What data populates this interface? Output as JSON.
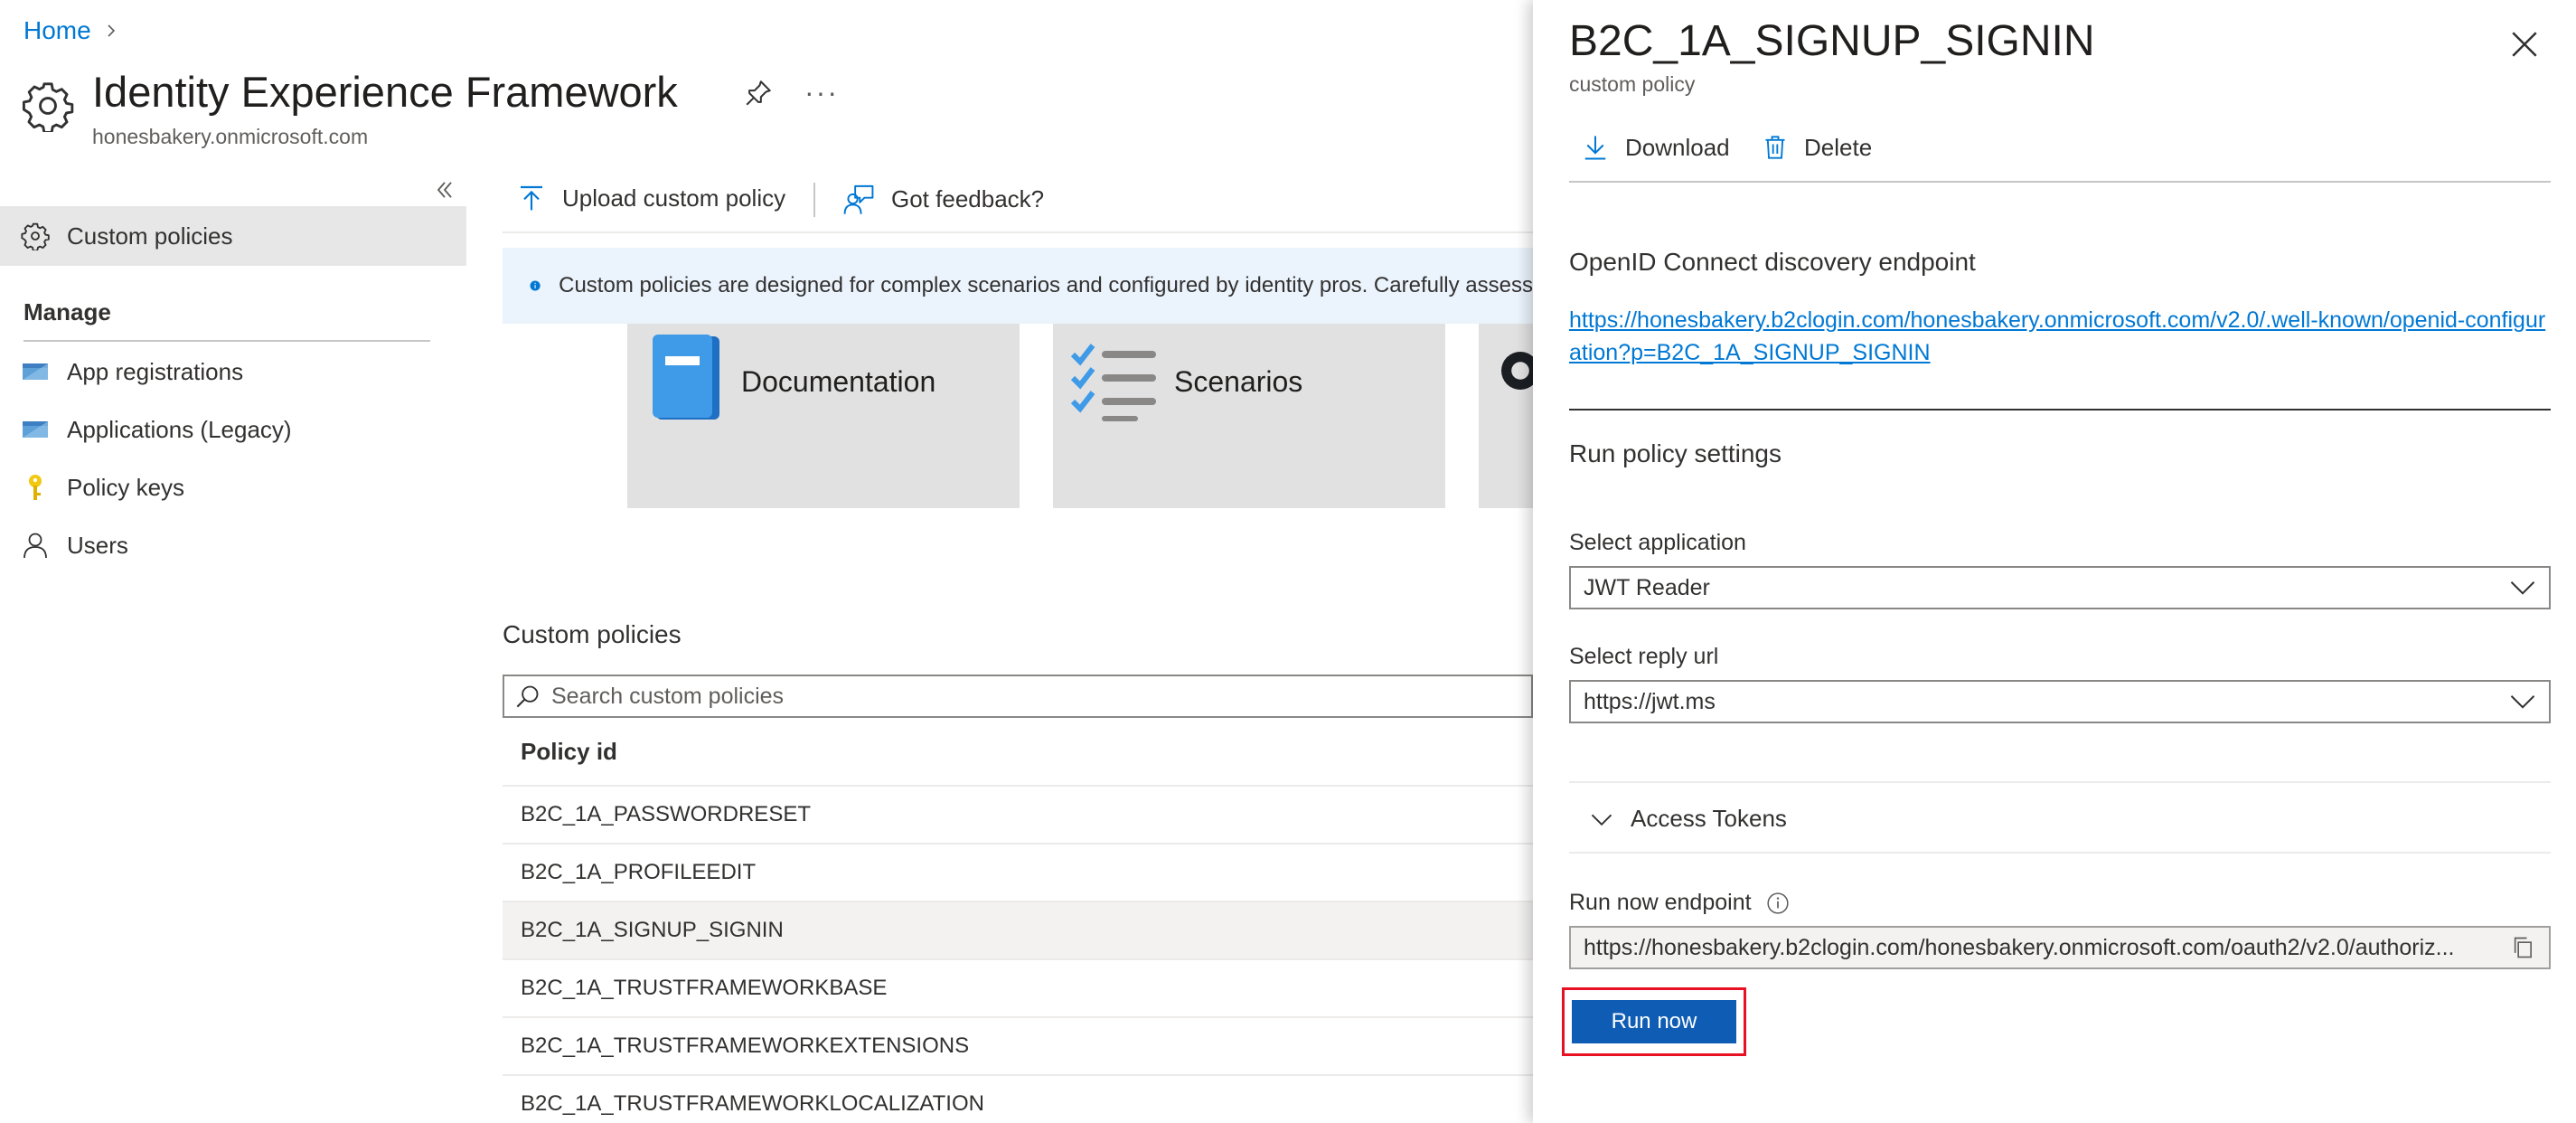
{
  "breadcrumb": {
    "home": "Home"
  },
  "header": {
    "title": "Identity Experience Framework",
    "tenant": "honesbakery.onmicrosoft.com",
    "more": "···"
  },
  "sidebar": {
    "active_item": "Custom policies",
    "manage_label": "Manage",
    "items": [
      {
        "label": "App registrations",
        "icon": "app-registrations-icon"
      },
      {
        "label": "Applications (Legacy)",
        "icon": "applications-legacy-icon"
      },
      {
        "label": "Policy keys",
        "icon": "key-icon"
      },
      {
        "label": "Users",
        "icon": "user-icon"
      }
    ]
  },
  "toolbar": {
    "upload": "Upload custom policy",
    "feedback": "Got feedback?"
  },
  "info": {
    "text": "Custom policies are designed for complex scenarios and configured by identity pros. Carefully assess"
  },
  "cards": [
    {
      "title": "Documentation"
    },
    {
      "title": "Scenarios"
    }
  ],
  "policies": {
    "title": "Custom policies",
    "search_placeholder": "Search custom policies",
    "column": "Policy id",
    "rows": [
      "B2C_1A_PASSWORDRESET",
      "B2C_1A_PROFILEEDIT",
      "B2C_1A_SIGNUP_SIGNIN",
      "B2C_1A_TRUSTFRAMEWORKBASE",
      "B2C_1A_TRUSTFRAMEWORKEXTENSIONS",
      "B2C_1A_TRUSTFRAMEWORKLOCALIZATION"
    ],
    "selected": "B2C_1A_SIGNUP_SIGNIN"
  },
  "panel": {
    "title": "B2C_1A_SIGNUP_SIGNIN",
    "subtitle": "custom policy",
    "download": "Download",
    "delete": "Delete",
    "discovery_heading": "OpenID Connect discovery endpoint",
    "discovery_url": "https://honesbakery.b2clogin.com/honesbakery.onmicrosoft.com/v2.0/.well-known/openid-configuration?p=B2C_1A_SIGNUP_SIGNIN",
    "run_settings_heading": "Run policy settings",
    "select_application_label": "Select application",
    "select_application_value": "JWT Reader",
    "select_reply_label": "Select reply url",
    "select_reply_value": "https://jwt.ms",
    "access_tokens": "Access Tokens",
    "run_endpoint_label": "Run now endpoint",
    "run_endpoint_value": "https://honesbakery.b2clogin.com/honesbakery.onmicrosoft.com/oauth2/v2.0/authoriz...",
    "run_button": "Run now"
  },
  "colors": {
    "accent": "#0078d4",
    "run_button": "#0f5cb5",
    "highlight_border": "#e81123",
    "info_bg": "#ebf3fc"
  }
}
